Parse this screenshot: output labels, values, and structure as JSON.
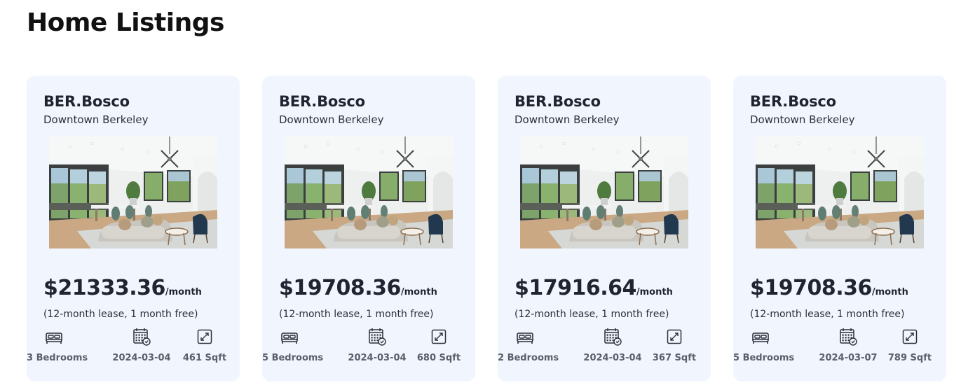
{
  "page": {
    "title": "Home Listings"
  },
  "listings": [
    {
      "name": "BER.Bosco",
      "area": "Downtown Berkeley",
      "price": "$21333.36",
      "per": "/month",
      "lease": "(12-month lease, 1 month free)",
      "bedrooms": "3 Bedrooms",
      "date": "2024-03-04",
      "sqft": "461 Sqft"
    },
    {
      "name": "BER.Bosco",
      "area": "Downtown Berkeley",
      "price": "$19708.36",
      "per": "/month",
      "lease": "(12-month lease, 1 month free)",
      "bedrooms": "5 Bedrooms",
      "date": "2024-03-04",
      "sqft": "680 Sqft"
    },
    {
      "name": "BER.Bosco",
      "area": "Downtown Berkeley",
      "price": "$17916.64",
      "per": "/month",
      "lease": "(12-month lease, 1 month free)",
      "bedrooms": "2 Bedrooms",
      "date": "2024-03-04",
      "sqft": "367 Sqft"
    },
    {
      "name": "BER.Bosco",
      "area": "Downtown Berkeley",
      "price": "$19708.36",
      "per": "/month",
      "lease": "(12-month lease, 1 month free)",
      "bedrooms": "5 Bedrooms",
      "date": "2024-03-07",
      "sqft": "789 Sqft"
    }
  ],
  "icons": {
    "bed": "bed-icon",
    "calendar": "calendar-icon",
    "size": "expand-icon"
  },
  "colors": {
    "card_bg": "#f1f6fe",
    "text": "#1f2430"
  }
}
